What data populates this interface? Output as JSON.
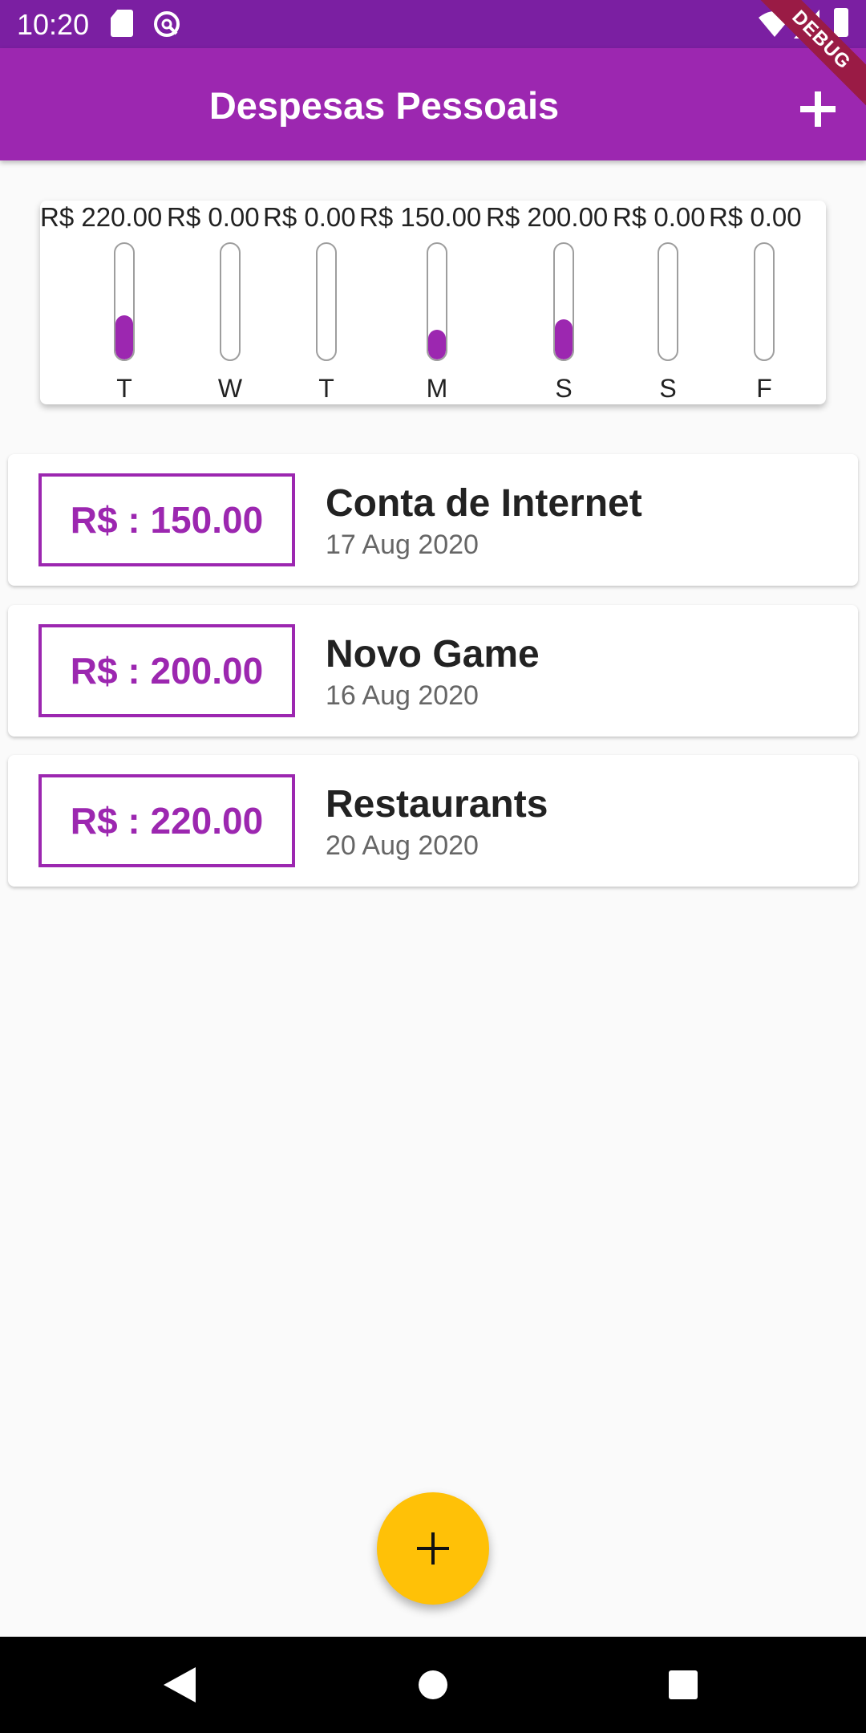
{
  "status_bar": {
    "time": "10:20",
    "icons": [
      "sd-card-icon",
      "vpn-icon",
      "wifi-icon",
      "signal-icon",
      "battery-icon"
    ]
  },
  "debug_banner": "DEBUG",
  "app_bar": {
    "title": "Despesas Pessoais",
    "action_icon": "plus-icon"
  },
  "colors": {
    "primary": "#9c27b0",
    "primary_dark": "#7b1fa2",
    "accent": "#ffc107"
  },
  "chart": {
    "bars": [
      {
        "day": "T",
        "amount": "R$ 220.00",
        "fraction": 0.38
      },
      {
        "day": "W",
        "amount": "R$ 0.00",
        "fraction": 0
      },
      {
        "day": "T",
        "amount": "R$ 0.00",
        "fraction": 0
      },
      {
        "day": "M",
        "amount": "R$ 150.00",
        "fraction": 0.26
      },
      {
        "day": "S",
        "amount": "R$ 200.00",
        "fraction": 0.35
      },
      {
        "day": "S",
        "amount": "R$ 0.00",
        "fraction": 0
      },
      {
        "day": "F",
        "amount": "R$ 0.00",
        "fraction": 0
      }
    ]
  },
  "transactions": [
    {
      "amount": "R$ : 150.00",
      "title": "Conta de Internet",
      "date": "17 Aug 2020"
    },
    {
      "amount": "R$ : 200.00",
      "title": "Novo Game",
      "date": "16 Aug 2020"
    },
    {
      "amount": "R$ : 220.00",
      "title": "Restaurants",
      "date": "20 Aug 2020"
    }
  ],
  "fab": {
    "icon": "plus-icon"
  },
  "nav_bar": {
    "icons": [
      "back-icon",
      "home-icon",
      "recents-icon"
    ]
  }
}
